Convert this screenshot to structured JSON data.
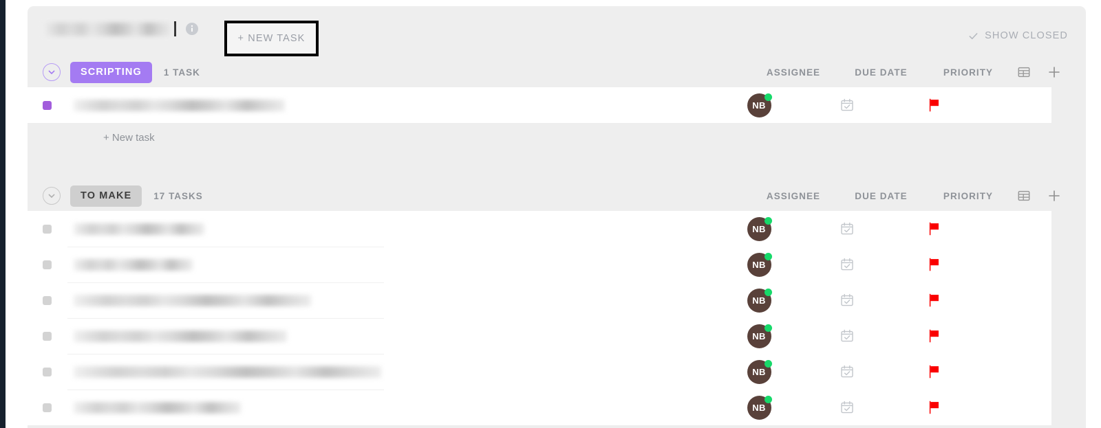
{
  "header": {
    "title_redacted": "",
    "info_icon": "info-icon",
    "new_task_label": "+ NEW TASK",
    "show_closed_label": "SHOW CLOSED",
    "show_closed_icon": "check-icon"
  },
  "columns": {
    "assignee": "ASSIGNEE",
    "due_date": "DUE DATE",
    "priority": "PRIORITY",
    "table_icon": "table-view-icon",
    "add_column_icon": "plus-icon"
  },
  "colors": {
    "accent_purple": "#a47bf2",
    "status_purple": "#a25ddc",
    "status_grey": "#d3d3d3",
    "group_grey": "#cfcfcf",
    "priority_flag": "#fa0000",
    "avatar_bg": "#59413a",
    "presence_dot": "#17d96a",
    "panel_bg": "#eeeeee",
    "row_bg": "#ffffff",
    "left_rail": "#16212e"
  },
  "icons": {
    "collapse": "chevron-down-circle-icon",
    "due_date": "calendar-check-icon",
    "priority": "flag-icon"
  },
  "add_task_label": "+ New task",
  "groups": [
    {
      "name": "SCRIPTING",
      "count_label": "1 TASK",
      "accent": "purple",
      "tasks": [
        {
          "name_redacted": "",
          "status": "purple",
          "width_class": "b1",
          "assignee": "NB",
          "due_date": "",
          "priority": "urgent"
        }
      ]
    },
    {
      "name": "TO MAKE",
      "count_label": "17 TASKS",
      "accent": "grey",
      "tasks": [
        {
          "name_redacted": "",
          "status": "grey",
          "width_class": "b2",
          "assignee": "NB",
          "due_date": "",
          "priority": "urgent"
        },
        {
          "name_redacted": "",
          "status": "grey",
          "width_class": "b3",
          "assignee": "NB",
          "due_date": "",
          "priority": "urgent"
        },
        {
          "name_redacted": "",
          "status": "grey",
          "width_class": "b4",
          "assignee": "NB",
          "due_date": "",
          "priority": "urgent"
        },
        {
          "name_redacted": "",
          "status": "grey",
          "width_class": "b5",
          "assignee": "NB",
          "due_date": "",
          "priority": "urgent"
        },
        {
          "name_redacted": "",
          "status": "grey",
          "width_class": "b6",
          "assignee": "NB",
          "due_date": "",
          "priority": "urgent"
        },
        {
          "name_redacted": "",
          "status": "grey",
          "width_class": "b7",
          "assignee": "NB",
          "due_date": "",
          "priority": "urgent"
        }
      ]
    }
  ]
}
